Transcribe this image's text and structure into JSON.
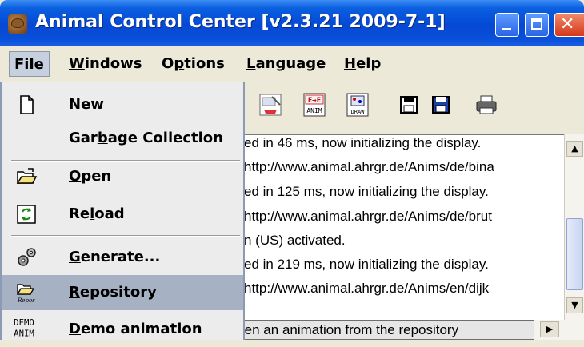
{
  "window": {
    "title": "Animal Control Center [v2.3.21 2009-7-1]"
  },
  "menubar": {
    "items": [
      {
        "label": "File",
        "mnemonic": "F",
        "rest": "ile",
        "active": true
      },
      {
        "label": "Windows",
        "mnemonic": "W",
        "rest": "indows"
      },
      {
        "label": "Options",
        "pre": "O",
        "mnemonic": "p",
        "rest": "tions"
      },
      {
        "label": "Language",
        "mnemonic": "L",
        "rest": "anguage"
      },
      {
        "label": "Help",
        "mnemonic": "H",
        "rest": "elp"
      }
    ]
  },
  "file_menu": {
    "new": {
      "label": "New",
      "mnemonic": "N",
      "rest": "ew",
      "icon": "new-document-icon"
    },
    "garbage": {
      "label": "Garbage Collection",
      "pre": "Gar",
      "mnemonic": "b",
      "rest": "age Collection"
    },
    "open": {
      "label": "Open",
      "mnemonic": "O",
      "rest": "pen",
      "icon": "open-folder-icon"
    },
    "reload": {
      "label": "Reload",
      "pre": "Re",
      "mnemonic": "l",
      "rest": "oad",
      "icon": "reload-icon"
    },
    "generate": {
      "label": "Generate...",
      "mnemonic": "G",
      "rest": "enerate...",
      "icon": "gears-icon"
    },
    "repository": {
      "label": "Repository",
      "mnemonic": "R",
      "rest": "epository",
      "icon": "repository-icon",
      "icon_text": "Repos"
    },
    "demo": {
      "label": "Demo animation",
      "mnemonic": "D",
      "rest": "emo animation",
      "icon": "demo-anim-icon",
      "icon_text_1": "DEMO",
      "icon_text_2": "ANIM"
    }
  },
  "toolbar": {
    "buttons": [
      {
        "icon": "image-edit-icon"
      },
      {
        "icon": "anim-convert-icon",
        "text_top": "E→E",
        "text_bottom": "ANIM"
      },
      {
        "icon": "draw-icon",
        "text_bottom": "DRAW"
      },
      {
        "icon": "save-icon"
      },
      {
        "icon": "save-as-icon"
      },
      {
        "icon": "print-icon"
      }
    ]
  },
  "log": {
    "lines": [
      "ed in 46 ms, now initializing the display.",
      "http://www.animal.ahrgr.de/Anims/de/bina",
      "ed in 125 ms, now initializing the display.",
      "http://www.animal.ahrgr.de/Anims/de/brut",
      "n (US) activated.",
      "ed in 219 ms, now initializing the display.",
      "http://www.animal.ahrgr.de/Anims/en/dijk"
    ]
  },
  "tooltip": {
    "text": "Open an animation from the repository"
  },
  "colors": {
    "titlebar": "#0548d4",
    "menu_selected": "#a6b1c3",
    "menu_bg": "#ececec"
  }
}
